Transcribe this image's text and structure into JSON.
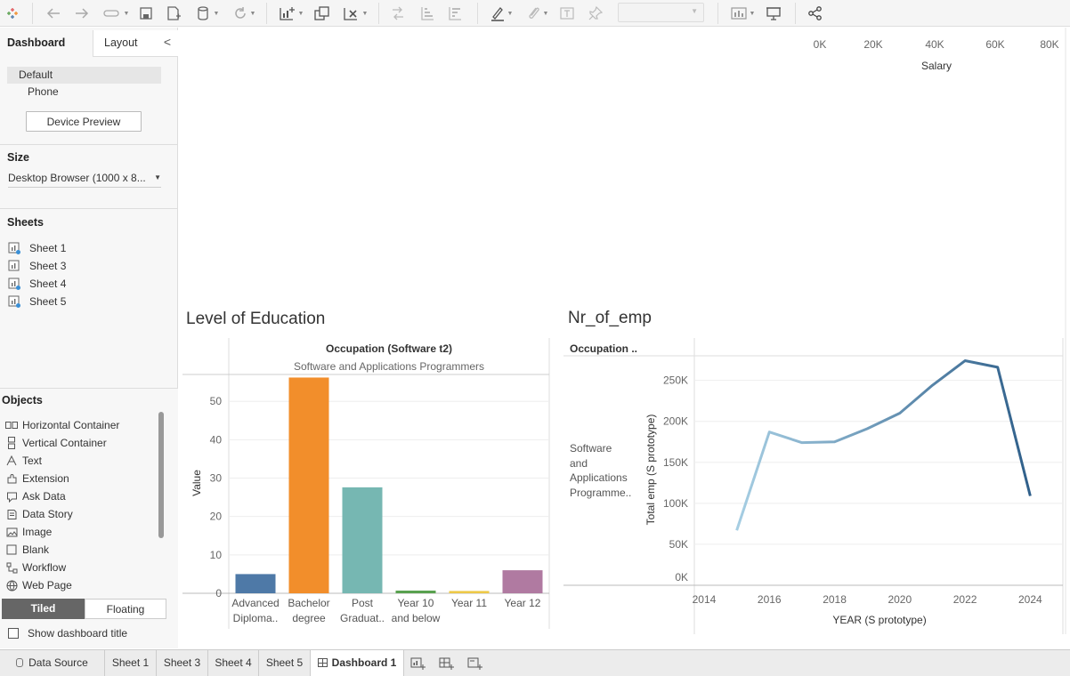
{
  "toolbar": {
    "icons": [
      "tableau-logo-icon",
      "back-icon",
      "forward-icon",
      "redirect-icon",
      "save-icon",
      "new-datasource-icon",
      "datasource-cylinder-icon",
      "refresh-icon",
      "new-worksheet-icon",
      "duplicate-icon",
      "clear-icon",
      "swap-icon",
      "sort-ascending-icon",
      "sort-descending-icon",
      "highlight-icon",
      "group-icon",
      "label-icon",
      "pin-icon",
      "show-me-icon",
      "presentation-icon",
      "share-icon"
    ]
  },
  "sidebar": {
    "tabs": {
      "dashboard": "Dashboard",
      "layout": "Layout",
      "collapse": "<"
    },
    "devices": {
      "default": "Default",
      "phone": "Phone"
    },
    "device_preview": "Device Preview",
    "size_heading": "Size",
    "size_value": "Desktop Browser (1000 x 8...",
    "sheets_heading": "Sheets",
    "sheets": [
      "Sheet 1",
      "Sheet 3",
      "Sheet 4",
      "Sheet 5"
    ],
    "objects_heading": "Objects",
    "objects": [
      {
        "label": "Horizontal Container",
        "icon": "horizontal-container-icon"
      },
      {
        "label": "Vertical Container",
        "icon": "vertical-container-icon"
      },
      {
        "label": "Text",
        "icon": "text-icon"
      },
      {
        "label": "Extension",
        "icon": "extension-icon"
      },
      {
        "label": "Ask Data",
        "icon": "ask-data-icon"
      },
      {
        "label": "Data Story",
        "icon": "data-story-icon"
      },
      {
        "label": "Image",
        "icon": "image-icon"
      },
      {
        "label": "Blank",
        "icon": "blank-icon"
      },
      {
        "label": "Workflow",
        "icon": "workflow-icon"
      },
      {
        "label": "Web Page",
        "icon": "web-page-icon"
      }
    ],
    "tiled": "Tiled",
    "floating": "Floating",
    "show_title": "Show dashboard title"
  },
  "top_axis": {
    "ticks": [
      "0K",
      "20K",
      "40K",
      "60K",
      "80K"
    ],
    "label": "Salary"
  },
  "chart_data": [
    {
      "type": "bar",
      "title": "Level of Education",
      "header": "Occupation (Software t2)",
      "subheader": "Software and Applications Programmers",
      "ylabel": "Value",
      "ylim": [
        0,
        57
      ],
      "yticks": [
        "0",
        "10",
        "20",
        "30",
        "40",
        "50"
      ],
      "categories": [
        [
          "Advanced",
          "Diploma.."
        ],
        [
          "Bachelor",
          "degree"
        ],
        [
          "Post",
          "Graduat.."
        ],
        [
          "Year 10",
          "and below"
        ],
        [
          "Year 11"
        ],
        [
          "Year 12"
        ]
      ],
      "values": [
        5,
        56.2,
        27.6,
        0.7,
        0.6,
        6
      ],
      "colors": [
        "#4e79a7",
        "#f28e2b",
        "#76b7b2",
        "#59a14f",
        "#edc948",
        "#b07aa1"
      ]
    },
    {
      "type": "line",
      "title": "Nr_of_emp",
      "row_header": "Occupation ..",
      "row_label": [
        "Software",
        "and",
        "Applications",
        "Programme.."
      ],
      "xlabel": "YEAR (S prototype)",
      "ylabel": "Total emp (S prototype)",
      "xticks": [
        "2014",
        "2016",
        "2018",
        "2020",
        "2022",
        "2024"
      ],
      "yticks": [
        "0K",
        "50K",
        "100K",
        "150K",
        "200K",
        "250K"
      ],
      "xlim": [
        2013.7,
        2025
      ],
      "ylim": [
        0,
        280000
      ],
      "x": [
        2015,
        2016,
        2017,
        2018,
        2019,
        2020,
        2021,
        2022,
        2023,
        2024
      ],
      "y": [
        67000,
        187000,
        174000,
        175000,
        191000,
        210000,
        244000,
        274000,
        266000,
        109000
      ],
      "color_start": "#a6cee3",
      "color_end": "#2f5f8a"
    }
  ],
  "bottom_tabs": {
    "datasource": "Data Source",
    "sheets": [
      "Sheet 1",
      "Sheet 3",
      "Sheet 4",
      "Sheet 5"
    ],
    "active": "Dashboard 1",
    "new_icons": [
      "new-sheet-icon",
      "new-dashboard-icon",
      "new-story-icon"
    ]
  }
}
